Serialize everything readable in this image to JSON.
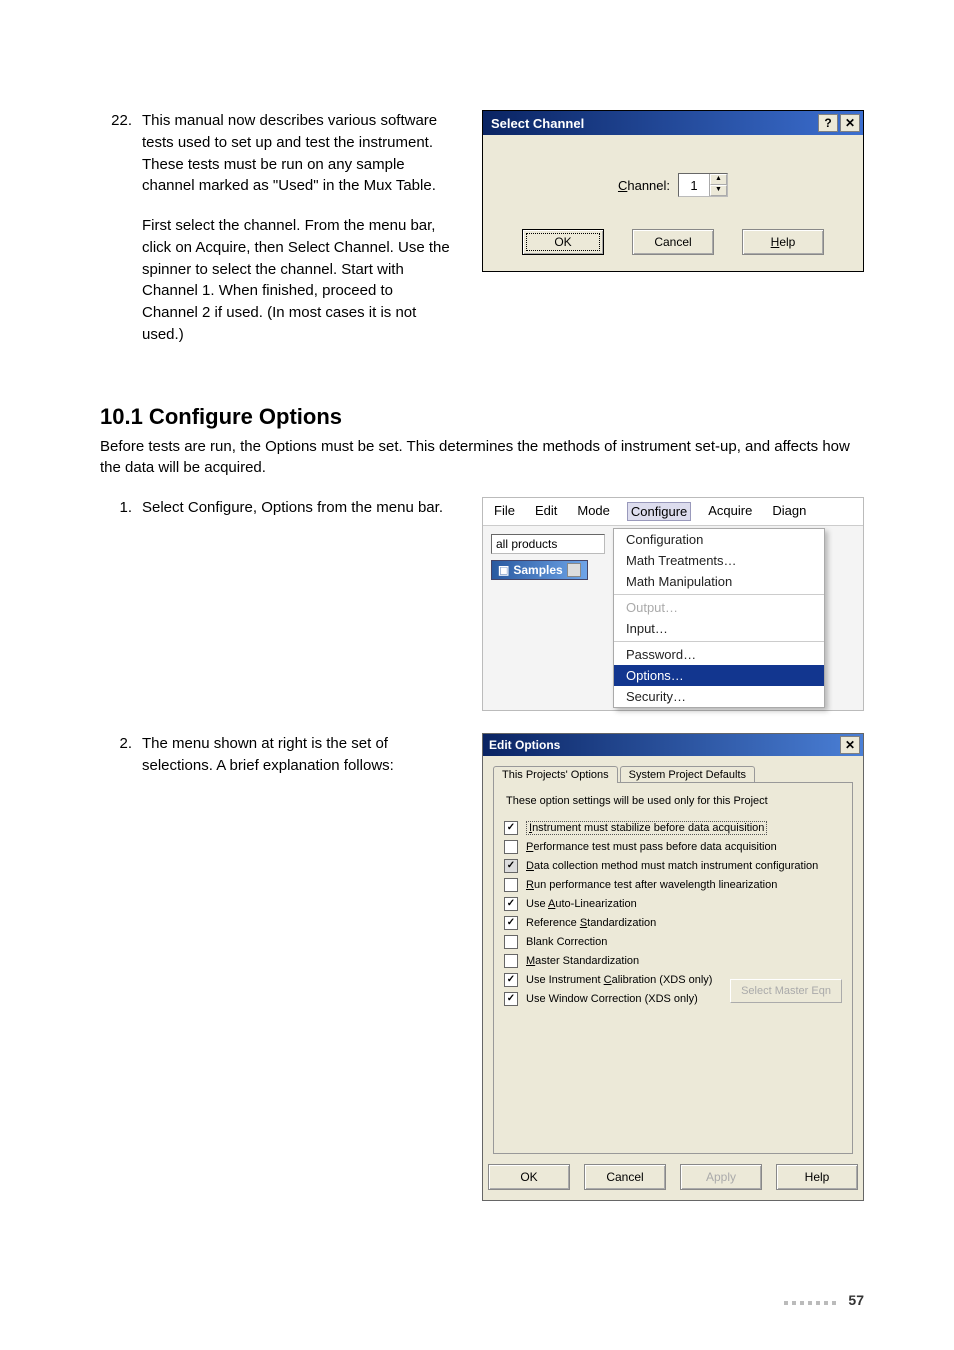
{
  "page_number": "57",
  "list22": {
    "num": "22.",
    "p1": "This manual now describes various software tests used to set up and test the instrument. These tests must be run on any sample channel marked as \"Used\" in the Mux Table.",
    "p2": "First select the channel. From the menu bar, click on Acquire, then Select Channel. Use the spinner to select the channel. Start with Channel 1. When finished, proceed to Channel 2 if used. (In most cases it is not used.)"
  },
  "select_channel": {
    "title": "Select Channel",
    "help_btn": "?",
    "close_btn": "✕",
    "label_pre": "C",
    "label_post": "hannel:",
    "value": "1",
    "ok": "OK",
    "cancel": "Cancel",
    "help_pre": "H",
    "help_post": "elp"
  },
  "heading": "10.1 Configure Options",
  "intro": "Before tests are run, the Options must be set. This determines the methods of instrument set-up, and affects how the data will be acquired.",
  "step1": {
    "num": "1.",
    "text": "Select Configure, Options from the menu bar."
  },
  "step2": {
    "num": "2.",
    "text": "The menu shown at right is the set of selections. A brief explanation follows:"
  },
  "menu": {
    "bar": [
      "File",
      "Edit",
      "Mode",
      "Configure",
      "Acquire",
      "Diagn"
    ],
    "all_products": "all products",
    "samples": "Samples",
    "items": [
      "Configuration",
      "Math Treatments…",
      "Math Manipulation"
    ],
    "output": "Output…",
    "input": "Input…",
    "password": "Password…",
    "options": "Options…",
    "security": "Security…"
  },
  "eo": {
    "title": "Edit Options",
    "close": "✕",
    "tab1": "This Projects' Options",
    "tab2": "System Project Defaults",
    "hint": "These option settings will be used only for this Project",
    "select_master": "Select Master Eqn",
    "ok": "OK",
    "cancel": "Cancel",
    "apply": "Apply",
    "help": "Help",
    "rows": [
      {
        "checked": true,
        "grey": false,
        "focus": true,
        "u": "I",
        "rest": "nstrument must stabilize before data acquisition"
      },
      {
        "checked": false,
        "grey": false,
        "focus": false,
        "u": "P",
        "rest": "erformance test must pass before data acquisition"
      },
      {
        "checked": true,
        "grey": true,
        "focus": false,
        "u": "D",
        "rest": "ata collection method must match instrument configuration"
      },
      {
        "checked": false,
        "grey": false,
        "focus": false,
        "u": "R",
        "rest": "un performance test after wavelength linearization"
      },
      {
        "checked": true,
        "grey": false,
        "focus": false,
        "u": "A",
        "rest": "uto-Linearization",
        "pre": "Use "
      },
      {
        "checked": true,
        "grey": false,
        "focus": false,
        "u": "S",
        "rest": "tandardization",
        "pre": "Reference "
      },
      {
        "checked": false,
        "grey": false,
        "focus": false,
        "u": "",
        "rest": "Blank Correction"
      },
      {
        "checked": false,
        "grey": false,
        "focus": false,
        "u": "M",
        "rest": "aster Standardization"
      },
      {
        "checked": true,
        "grey": false,
        "focus": false,
        "u": "C",
        "rest": "alibration (XDS only)",
        "pre": "Use Instrument "
      },
      {
        "checked": true,
        "grey": false,
        "focus": false,
        "u": "",
        "rest": "Use Window Correction (XDS only)"
      }
    ]
  }
}
